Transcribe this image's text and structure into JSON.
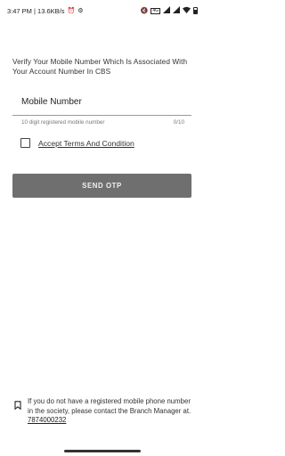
{
  "status_bar": {
    "time_speed": "3:47 PM | 13.6KB/s",
    "left_icons": [
      "alarm-icon",
      "settings-icon"
    ],
    "right_icons": [
      "mute-icon",
      "volte-icon",
      "signal-icon",
      "signal-icon",
      "wifi-icon",
      "battery-icon"
    ]
  },
  "instruction": "Verify Your Mobile Number Which Is Associated With Your Account Number In CBS",
  "mobile_field": {
    "placeholder": "Mobile Number",
    "helper": "10 digit registered mobile number",
    "counter": "0/10"
  },
  "terms": {
    "label": "Accept Terms And Condition",
    "checked": false
  },
  "send_button": "SEND OTP",
  "footer": {
    "text": "If you do not have a registered mobile phone number in the society, please contact the Branch Manager at.",
    "phone": "7874000232"
  },
  "colors": {
    "button_bg": "#6f6f6f",
    "text": "#333333"
  }
}
